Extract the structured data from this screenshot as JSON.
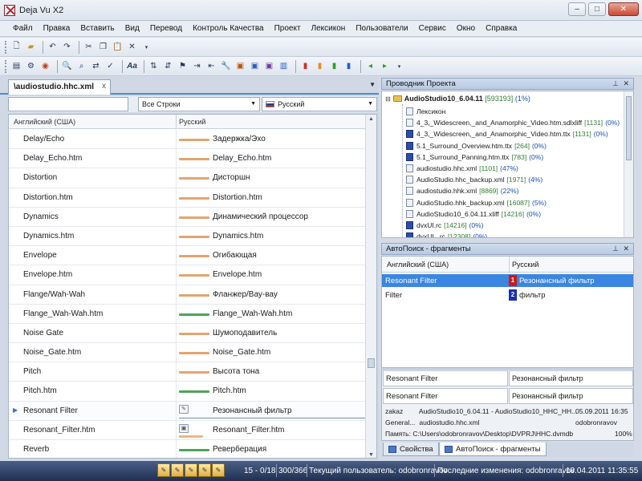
{
  "window": {
    "title": "Deja Vu X2",
    "minimize": "–",
    "maximize": "□",
    "close": "✕"
  },
  "menu": [
    "Файл",
    "Правка",
    "Вставить",
    "Вид",
    "Перевод",
    "Контроль Качества",
    "Проект",
    "Лексикон",
    "Пользователи",
    "Сервис",
    "Окно",
    "Справка"
  ],
  "document": {
    "tab_title": "\\audiostudio.hhc.xml",
    "tab_close": "x",
    "filter_select": "Все Строки",
    "language_select": "Русский",
    "col_source": "Английский (США)",
    "col_target": "Русский",
    "rows": [
      {
        "source": "Delay/Echo",
        "target": "Задержка/Эхо",
        "status": "orange"
      },
      {
        "source": "Delay_Echo.htm",
        "target": "Delay_Echo.htm",
        "status": "orange"
      },
      {
        "source": "Distortion",
        "target": "Дисторшн",
        "status": "orange"
      },
      {
        "source": "Distortion.htm",
        "target": "Distortion.htm",
        "status": "orange"
      },
      {
        "source": "Dynamics",
        "target": "Динамический процессор",
        "status": "orange"
      },
      {
        "source": "Dynamics.htm",
        "target": "Dynamics.htm",
        "status": "orange"
      },
      {
        "source": "Envelope",
        "target": "Огибающая",
        "status": "orange"
      },
      {
        "source": "Envelope.htm",
        "target": "Envelope.htm",
        "status": "orange"
      },
      {
        "source": "Flange/Wah-Wah",
        "target": "Фланжер/Вау-вау",
        "status": "orange"
      },
      {
        "source": "Flange_Wah-Wah.htm",
        "target": "Flange_Wah-Wah.htm",
        "status": "green"
      },
      {
        "source": "Noise Gate",
        "target": "Шумоподавитель",
        "status": "orange"
      },
      {
        "source": "Noise_Gate.htm",
        "target": "Noise_Gate.htm",
        "status": "orange"
      },
      {
        "source": "Pitch",
        "target": "Высота тона",
        "status": "orange"
      },
      {
        "source": "Pitch.htm",
        "target": "Pitch.htm",
        "status": "green"
      },
      {
        "source": "Resonant Filter",
        "target": "Резонансный фильтр",
        "status": "current"
      },
      {
        "source": "Resonant_Filter.htm",
        "target": "Resonant_Filter.htm",
        "status": "lock"
      },
      {
        "source": "Reverb",
        "target": "Реверберация",
        "status": "green"
      }
    ]
  },
  "explorer": {
    "title": "Проводник Проекта",
    "root_name": "AudioStudio10_6.04.11",
    "root_count": "[593193]",
    "root_pct": "(1%)",
    "items": [
      {
        "name": "Лексикон",
        "count": "",
        "pct": "",
        "icon": "doc"
      },
      {
        "name": "4_3,_Widescreen,_and_Anamorphic_Video.htm.sdlxliff",
        "count": "[1131]",
        "pct": "(0%)",
        "icon": "doc"
      },
      {
        "name": "4_3,_Widescreen,_and_Anamorphic_Video.htm.ttx",
        "count": "[1131]",
        "pct": "(0%)",
        "icon": "blue"
      },
      {
        "name": "5.1_Surround_Overview.htm.ttx",
        "count": "[264]",
        "pct": "(0%)",
        "icon": "blue"
      },
      {
        "name": "5.1_Surround_Panning.htm.ttx",
        "count": "[783]",
        "pct": "(0%)",
        "icon": "blue"
      },
      {
        "name": "audiostudio.hhc.xml",
        "count": "[1101]",
        "pct": "(47%)",
        "icon": "doc"
      },
      {
        "name": "AudioStudio.hhc_backup.xml",
        "count": "[1971]",
        "pct": "(4%)",
        "icon": "doc"
      },
      {
        "name": "audiostudio.hhk.xml",
        "count": "[8869]",
        "pct": "(22%)",
        "icon": "doc"
      },
      {
        "name": "AudioStudio.hhk_backup.xml",
        "count": "[16087]",
        "pct": "(5%)",
        "icon": "doc"
      },
      {
        "name": "AudioStudio10_6.04.11.xliff",
        "count": "[14216]",
        "pct": "(0%)",
        "icon": "doc"
      },
      {
        "name": "dvxUI.rc",
        "count": "[14216]",
        "pct": "(0%)",
        "icon": "blue"
      },
      {
        "name": "dvxUI_.rc",
        "count": "[12308]",
        "pct": "(0%)",
        "icon": "blue"
      }
    ]
  },
  "autosearch": {
    "title": "АвтоПоиск - фрагменты",
    "col_source": "Английский (США)",
    "col_target": "Русский",
    "rows": [
      {
        "source": "Resonant Filter",
        "num": "1",
        "target": "Резонансный фильтр",
        "color": "#d01818"
      },
      {
        "source": "Filter",
        "num": "2",
        "target": "фильтр",
        "color": "#1a2fb0"
      }
    ]
  },
  "properties": {
    "source1": "Resonant Filter",
    "target1": "Резонансный фильтр",
    "source2": "Resonant Filter",
    "target2": "Резонансный фильтр",
    "line1_key": "zakaz",
    "line1_val": "AudioStudio10_6.04.11 - AudioStudio10_HHC_HH...",
    "line1_date": "05.09.2011 16:35",
    "line2_key": "General...",
    "line2_val": "audiostudio.hhc.xml",
    "line2_user": "odobronravov",
    "line3": "Память: C:\\Users\\odobronravov\\Desktop\\DVPRJ\\HHC.dvmdb",
    "line3_pct": "100%"
  },
  "bottom_tabs": {
    "props": "Свойства",
    "autosearch": "АвтоПоиск - фрагменты"
  },
  "status": {
    "range": "15 - 0/18",
    "count": "300/366",
    "current_user": "Текущий пользователь: odobronravov",
    "last_change": "Последние изменения: odobronravov",
    "datetime": "18.04.2011 11:35:55"
  }
}
